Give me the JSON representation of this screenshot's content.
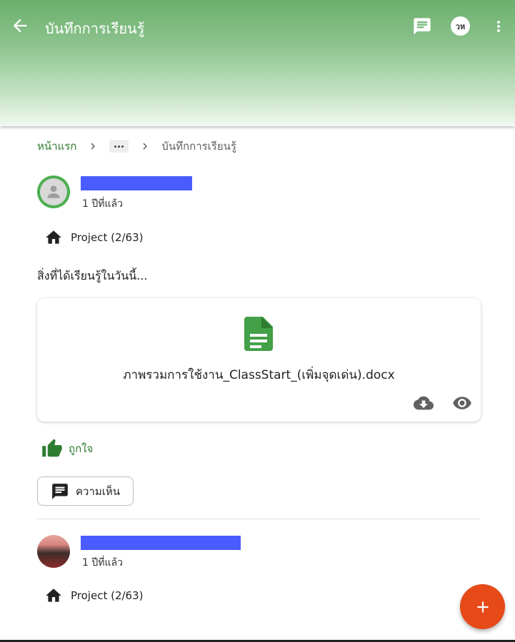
{
  "appbar": {
    "title": "บันทึกการเรียนรู้",
    "user_initials": "วห"
  },
  "breadcrumb": {
    "home": "หน้าแรก",
    "current": "บันทึกการเรียนรู้"
  },
  "posts": [
    {
      "time": "1 ปีที่แล้ว",
      "project": "Project (2/63)",
      "text": "สิ่งที่ได้เรียนรู้ในวันนี้...",
      "attachment": {
        "filename": "ภาพรวมการใช้งาน_ClassStart_(เพิ่มจุดเด่น).docx"
      },
      "like_label": "ถูกใจ",
      "comment_label": "ความเห็น"
    },
    {
      "time": "1 ปีที่แล้ว",
      "project": "Project (2/63)"
    }
  ],
  "colors": {
    "accent_green": "#2e7d32",
    "redaction": "#4a5cff",
    "fab": "#e64a19"
  }
}
